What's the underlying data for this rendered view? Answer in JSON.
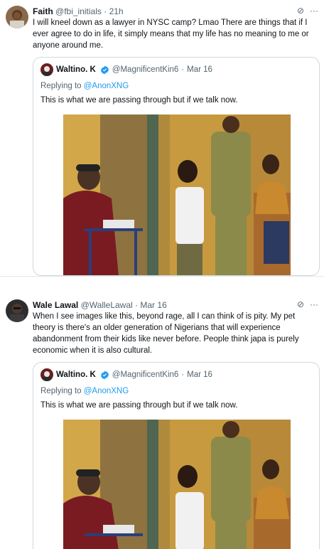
{
  "tweets": [
    {
      "author": "Faith",
      "handle": "@fbi_initials",
      "sep": "·",
      "time": "21h",
      "text": "I will kneel down as a lawyer in NYSC camp? Lmao There are things that if I ever agree to do in life, it simply means that my life has no meaning to me or anyone around me.",
      "quote": {
        "author": "Waltino. K",
        "handle": "@MagnificentKin6",
        "sep": "·",
        "time": "Mar 16",
        "replying_prefix": "Replying to ",
        "replying_to": "@AnonXNG",
        "text": "This is what we are passing through but if we talk now."
      }
    },
    {
      "author": "Wale Lawal",
      "handle": "@WalleLawal",
      "sep": "·",
      "time": "Mar 16",
      "text": "When I see images like this, beyond rage, all I can think of is pity. My pet theory is there's an older generation of Nigerians that will experience abandonment from their kids like never before. People think japa is purely economic when it is also cultural.",
      "quote": {
        "author": "Waltino. K",
        "handle": "@MagnificentKin6",
        "sep": "·",
        "time": "Mar 16",
        "replying_prefix": "Replying to ",
        "replying_to": "@AnonXNG",
        "text": "This is what we are passing through but if we talk now."
      }
    }
  ],
  "icons": {
    "grok": "⊘",
    "more": "···"
  },
  "colors": {
    "verified": "#1d9bf0",
    "link": "#1d9bf0",
    "muted": "#536471",
    "border": "#cfd9de"
  }
}
